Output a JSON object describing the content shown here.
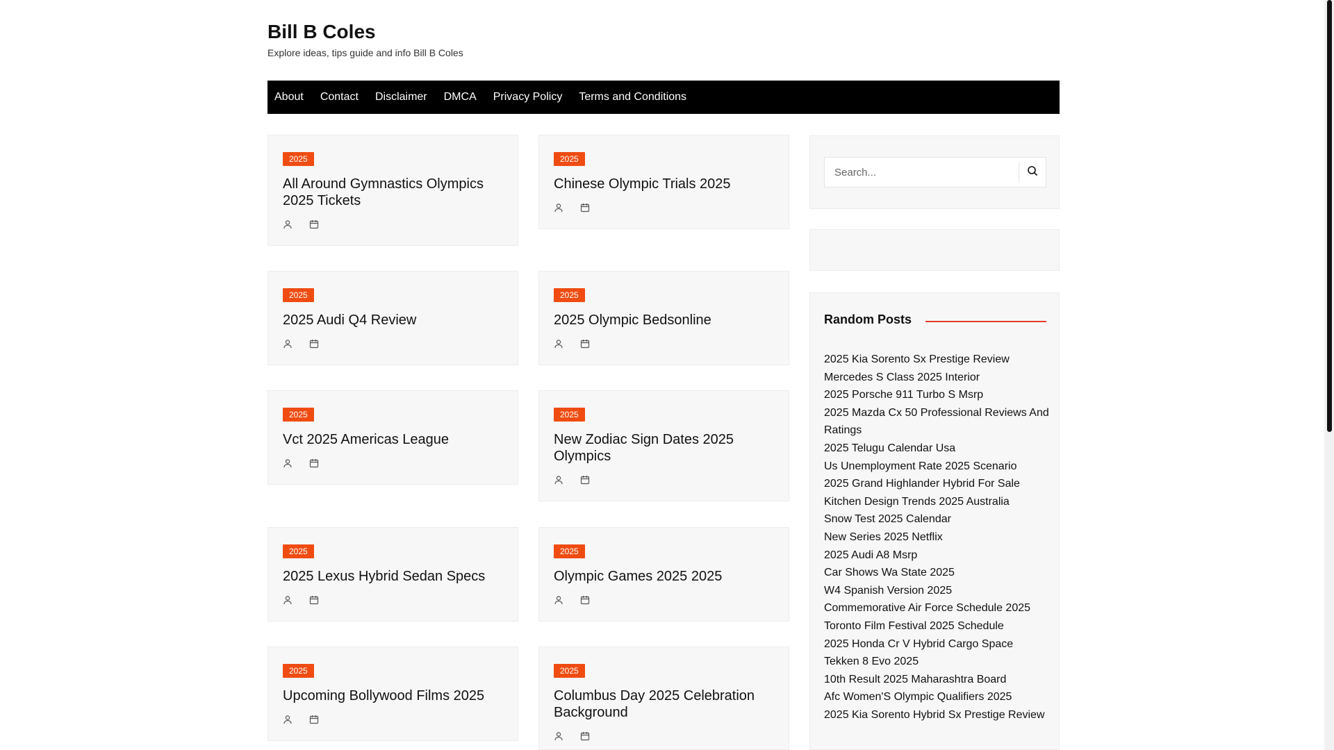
{
  "site": {
    "title": "Bill B Coles",
    "tagline": "Explore ideas, tips guide and info Bill B Coles"
  },
  "nav": {
    "items": [
      "About",
      "Contact",
      "Disclaimer",
      "DMCA",
      "Privacy Policy",
      "Terms and Conditions"
    ]
  },
  "posts": [
    {
      "category": "2025",
      "title": "All Around Gymnastics Olympics 2025 Tickets"
    },
    {
      "category": "2025",
      "title": "Chinese Olympic Trials 2025"
    },
    {
      "category": "2025",
      "title": "2025 Audi Q4 Review"
    },
    {
      "category": "2025",
      "title": "2025 Olympic Bedsonline"
    },
    {
      "category": "2025",
      "title": "Vct 2025 Americas League"
    },
    {
      "category": "2025",
      "title": "New Zodiac Sign Dates 2025 Olympics"
    },
    {
      "category": "2025",
      "title": "2025 Lexus Hybrid Sedan Specs"
    },
    {
      "category": "2025",
      "title": "Olympic Games 2025 2025"
    },
    {
      "category": "2025",
      "title": "Upcoming Bollywood Films 2025"
    },
    {
      "category": "2025",
      "title": "Columbus Day 2025 Celebration Background"
    }
  ],
  "sidebar": {
    "search": {
      "placeholder": "Search..."
    },
    "random_posts": {
      "title": "Random Posts",
      "items": [
        "2025 Kia Sorento Sx Prestige Review",
        "Mercedes S Class 2025 Interior",
        "2025 Porsche 911 Turbo S Msrp",
        "2025 Mazda Cx 50 Professional Reviews And Ratings",
        "2025 Telugu Calendar Usa",
        "Us Unemployment Rate 2025 Scenario",
        "2025 Grand Highlander Hybrid For Sale",
        "Kitchen Design Trends 2025 Australia",
        "Snow Test 2025 Calendar",
        "New Series 2025 Netflix",
        "2025 Audi A8 Msrp",
        "Car Shows Wa State 2025",
        "W4 Spanish Version 2025",
        "Commemorative Air Force Schedule 2025",
        "Toronto Film Festival 2025 Schedule",
        "2025 Honda Cr V Hybrid Cargo Space",
        "Tekken 8 Evo 2025",
        "10th Result 2025 Maharashtra Board",
        "Afc Women'S Olympic Qualifiers 2025",
        "2025 Kia Sorento Hybrid Sx Prestige Review"
      ]
    }
  },
  "colors": {
    "accent": "#f04c12",
    "nav_bg": "#000000",
    "card_bg": "#f7f7f7",
    "widget_line": "#e33d2b"
  },
  "icons": {
    "author": "user-icon",
    "date": "calendar-icon",
    "search": "search-icon"
  }
}
